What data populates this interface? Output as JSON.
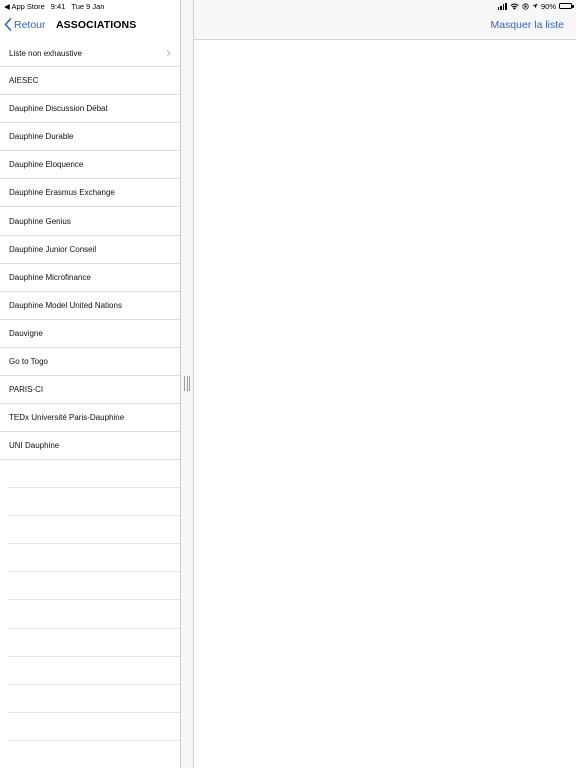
{
  "status_bar": {
    "back_app": "◀ App Store",
    "time": "9:41",
    "date": "Tue 9 Jan",
    "battery_percent": "90%",
    "battery_level": 0.9
  },
  "master": {
    "back_label": "Retour",
    "title": "ASSOCIATIONS",
    "items": [
      {
        "label": "Liste non exhaustive",
        "has_chevron": true
      },
      {
        "label": "AIESEC"
      },
      {
        "label": "Dauphine Discussion Débat"
      },
      {
        "label": "Dauphine Durable"
      },
      {
        "label": "Dauphine Eloquence"
      },
      {
        "label": "Dauphine Erasmus Exchange"
      },
      {
        "label": "Dauphine Genius"
      },
      {
        "label": "Dauphine Junior Conseil"
      },
      {
        "label": "Dauphine Microfinance"
      },
      {
        "label": "Dauphine Model United Nations"
      },
      {
        "label": "Dauvigne"
      },
      {
        "label": "Go to Togo"
      },
      {
        "label": "PARIS-CI"
      },
      {
        "label": "TEDx Université Paris-Dauphine"
      },
      {
        "label": "UNI Dauphine"
      }
    ]
  },
  "detail": {
    "hide_list_label": "Masquer la liste"
  },
  "colors": {
    "accent": "#2b66cf",
    "separator": "#dcdcdc",
    "nav_background": "#f7f7f7"
  }
}
